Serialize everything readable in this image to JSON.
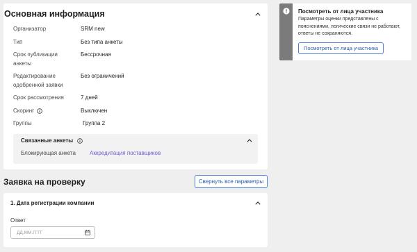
{
  "main_info": {
    "title": "Основная информация",
    "rows": [
      {
        "label": "Организатор",
        "value": "SRM new"
      },
      {
        "label": "Тип",
        "value": "Без типа анкеты"
      },
      {
        "label": "Срок публикации анкеты",
        "value": "Бессрочная"
      },
      {
        "label": "Редактирование одобренной заявки",
        "value": "Без ограничений"
      },
      {
        "label": "Срок рассмотрения",
        "value": "7 дней"
      },
      {
        "label": "Скоринг",
        "value": "Выключен"
      },
      {
        "label": "Группы",
        "value": "Группа 2"
      }
    ]
  },
  "linked": {
    "title": "Связанные анкеты",
    "rows": [
      {
        "label": "Блокирующая анкета",
        "value": "Аккредитация поставщиков"
      }
    ]
  },
  "review": {
    "title": "Заявка на проверку",
    "collapse_button": "Свернуть все параметры"
  },
  "question": {
    "title": "1. Дата регистрации компании",
    "answer_label": "Ответ",
    "date_placeholder": "ДД.ММ.ГГГГ"
  },
  "notice": {
    "title": "Посмотреть от лица участника",
    "text_lines": [
      "Параметры оценки представлены с",
      "пояснениями, логические связи не работают,",
      "ответы не сохраняются."
    ],
    "button": "Посмотреть от лица участника"
  },
  "icons": {
    "collapse": "chevron-up-icon",
    "info": "info-icon",
    "calendar": "calendar-icon",
    "alert": "exclamation-icon"
  },
  "colors": {
    "background": "#efefef",
    "link": "#6f5bd3",
    "button_border": "#4a80d8",
    "notice_strip": "#7b7b7b"
  }
}
